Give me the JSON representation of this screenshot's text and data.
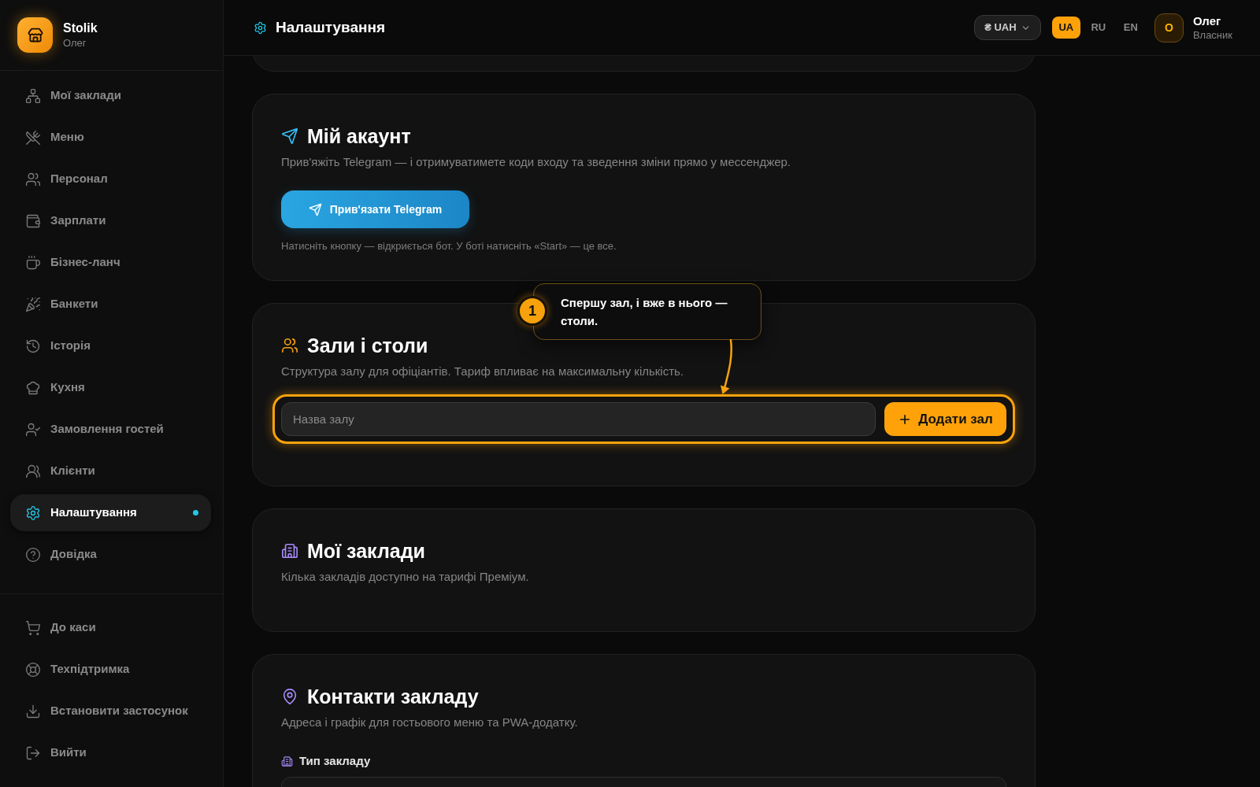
{
  "sidebar": {
    "brand": {
      "name": "Stolik",
      "user": "Олег"
    },
    "nav_items": [
      {
        "label": "Мої заклади",
        "selected": false
      },
      {
        "label": "Меню",
        "selected": false
      },
      {
        "label": "Персонал",
        "selected": false
      },
      {
        "label": "Зарплати",
        "selected": false
      },
      {
        "label": "Бізнес-ланч",
        "selected": false
      },
      {
        "label": "Банкети",
        "selected": false
      },
      {
        "label": "Історія",
        "selected": false
      },
      {
        "label": "Кухня",
        "selected": false
      },
      {
        "label": "Замовлення гостей",
        "selected": false
      },
      {
        "label": "Клієнти",
        "selected": false
      },
      {
        "label": "Налаштування",
        "selected": true
      },
      {
        "label": "Довідка",
        "selected": false
      }
    ],
    "footer_items": [
      {
        "label": "До каси"
      },
      {
        "label": "Техпідтримка"
      },
      {
        "label": "Встановити застосунок"
      },
      {
        "label": "Вийти"
      }
    ]
  },
  "header": {
    "title": "Налаштування",
    "currency": "₴ UAH",
    "languages": [
      {
        "label": "UA",
        "selected": true
      },
      {
        "label": "RU",
        "selected": false
      },
      {
        "label": "EN",
        "selected": false
      }
    ],
    "user": {
      "initial": "О",
      "name": "Олег",
      "role": "Власник"
    }
  },
  "sections": [
    {
      "kind": "telegram",
      "title": "Мій акаунт",
      "description": "Прив'яжіть Telegram — і отримуватимете коди входу та зведення зміни прямо у мессенджер.",
      "button": "Прив'язати Telegram",
      "hint": "Натисніть кнопку — відкриється бот. У боті натисніть «Start» — це все."
    },
    {
      "kind": "halls",
      "title": "Зали і столи",
      "description": "Структура залу для офіціантів. Тариф впливає на максимальну кількість.",
      "input": {
        "placeholder": "Назва залу"
      },
      "button": "Додати зал",
      "tooltip": {
        "step": "1",
        "text": "Спершу зал, і вже в нього — столи."
      }
    },
    {
      "kind": "venues",
      "title": "Мої заклади",
      "description": "Кілька закладів доступно на тарифі Преміум."
    },
    {
      "kind": "contacts",
      "title": "Контакти закладу",
      "description": "Адреса і графік для гостьового меню та PWA-додатку.",
      "field": {
        "label": "Тип закладу"
      }
    }
  ]
}
